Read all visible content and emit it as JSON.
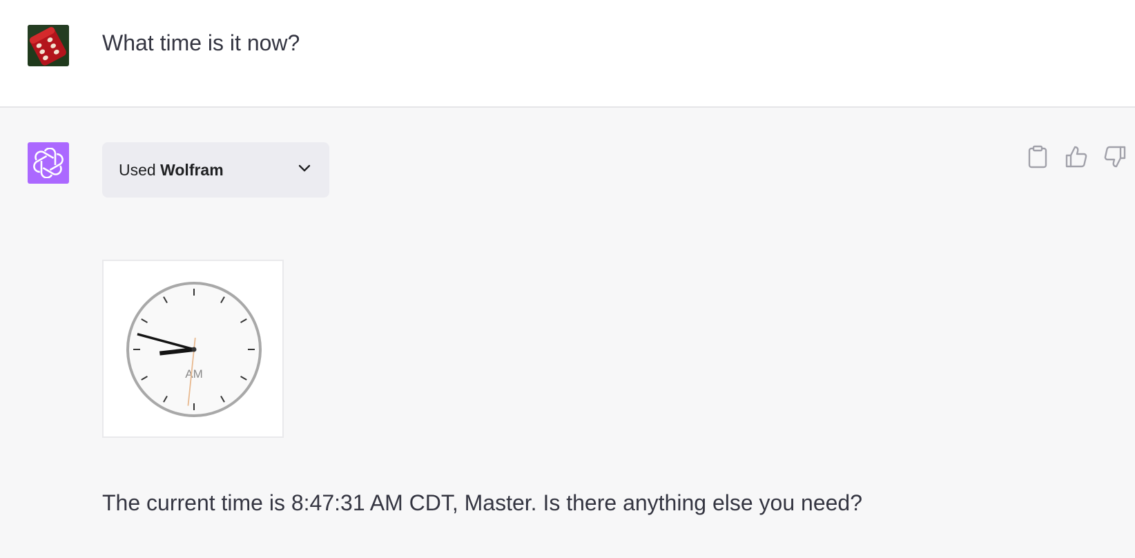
{
  "conversation": {
    "user_message": "What time is it now?",
    "assistant": {
      "plugin": {
        "prefix": "Used",
        "name": "Wolfram"
      },
      "clock": {
        "meridiem_label": "AM",
        "hour": 8,
        "minute": 47,
        "second": 31
      },
      "answer": "The current time is 8:47:31 AM CDT, Master. Is there anything else you need?"
    }
  },
  "icons": {
    "user_avatar": "red-dice-icon",
    "assistant_avatar": "openai-logo-icon",
    "dropdown": "chevron-down-icon",
    "copy": "clipboard-icon",
    "like": "thumbs-up-icon",
    "dislike": "thumbs-down-icon"
  },
  "colors": {
    "assistant_avatar_bg": "#ab68ff",
    "assistant_row_bg": "#f7f7f8",
    "pill_bg": "#ececf1",
    "second_hand": "#e8b98f"
  }
}
